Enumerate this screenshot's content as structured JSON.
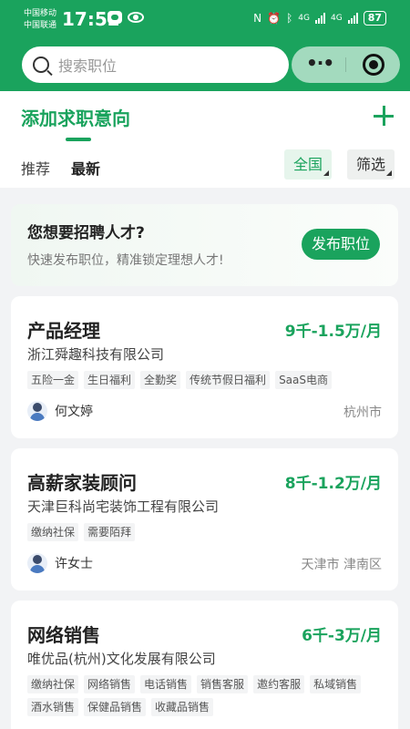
{
  "status_bar": {
    "carrier_1": "中国移动",
    "carrier_2": "中国联通",
    "time": "17:52",
    "network_1": "4G",
    "network_2": "4G",
    "battery": "87"
  },
  "search": {
    "placeholder": "搜索职位"
  },
  "header": {
    "title": "添加求职意向"
  },
  "tabs": [
    {
      "label": "推荐"
    },
    {
      "label": "最新"
    }
  ],
  "filters": {
    "region": "全国",
    "filter": "筛选"
  },
  "promo": {
    "title": "您想要招聘人才?",
    "subtitle": "快速发布职位，精准锁定理想人才!",
    "button": "发布职位"
  },
  "jobs": [
    {
      "title": "产品经理",
      "salary": "9千-1.5万/月",
      "company": "浙江舜趣科技有限公司",
      "tags": [
        "五险一金",
        "生日福利",
        "全勤奖",
        "传统节假日福利",
        "SaaS电商"
      ],
      "recruiter": "何文婷",
      "city": "杭州市"
    },
    {
      "title": "高薪家装顾问",
      "salary": "8千-1.2万/月",
      "company": "天津巨科尚宅装饰工程有限公司",
      "tags": [
        "缴纳社保",
        "需要陌拜"
      ],
      "recruiter": "许女士",
      "city": "天津市 津南区"
    },
    {
      "title": "网络销售",
      "salary": "6千-3万/月",
      "company": "唯优品(杭州)文化发展有限公司",
      "tags": [
        "缴纳社保",
        "网络销售",
        "电话销售",
        "销售客服",
        "邀约客服",
        "私域销售",
        "酒水销售",
        "保健品销售",
        "收藏品销售"
      ]
    }
  ],
  "colors": {
    "brand_green": "#1aa35d",
    "page_bg": "#f2f3f5"
  }
}
